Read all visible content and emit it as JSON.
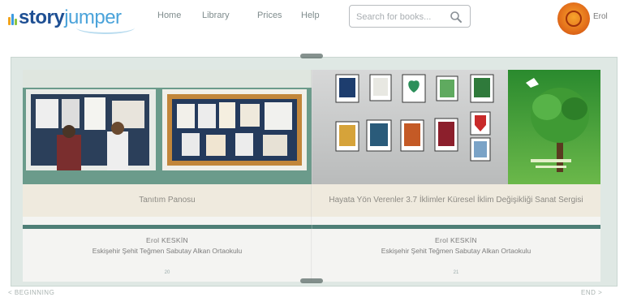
{
  "header": {
    "logo": {
      "part1": "story",
      "part2": "jumper"
    },
    "nav": [
      "Home",
      "Library",
      "Prices",
      "Help"
    ],
    "search": {
      "placeholder": "Search for books...",
      "value": ""
    },
    "user": {
      "name": "Erol"
    }
  },
  "book": {
    "left_page": {
      "caption": "Tanıtım Panosu",
      "author_name": "Erol KESKİN",
      "author_school": "Eskişehir Şehit Teğmen Sabutay Alkan Ortaokulu",
      "page_number": "20"
    },
    "right_page": {
      "caption": "Hayata Yön Verenler 3.7 İklimler Küresel İklim Değişikliği Sanat Sergisi",
      "author_name": "Erol KESKİN",
      "author_school": "Eskişehir Şehit Teğmen Sabutay Alkan Ortaokulu",
      "page_number": "21"
    }
  },
  "footer": {
    "beginning_label": "< BEGINNING",
    "end_label": "END >"
  },
  "colors": {
    "logo_dark": "#1e4f93",
    "logo_light": "#4aa3da",
    "divider_teal": "#4e7f77",
    "caption_bg": "#efeade",
    "frame_bg": "#dfe8e4"
  },
  "icons": [
    "search-icon",
    "logo-bars-icon",
    "avatar-emblem-icon"
  ]
}
